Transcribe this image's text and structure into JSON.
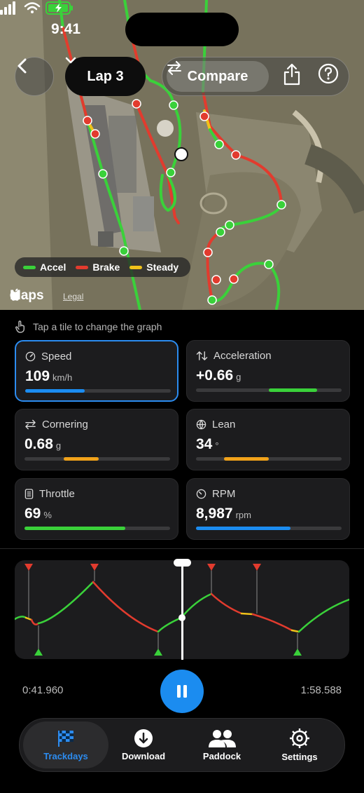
{
  "status_bar": {
    "time": "9:41"
  },
  "map": {
    "lap_label": "Lap 3",
    "compare_label": "Compare",
    "legend": [
      {
        "label": "Accel",
        "color": "#3ad13a"
      },
      {
        "label": "Brake",
        "color": "#e23b2e"
      },
      {
        "label": "Steady",
        "color": "#f0c21a"
      }
    ],
    "attribution": "Maps",
    "legal_label": "Legal"
  },
  "hint": "Tap a tile to change the graph",
  "tiles": [
    {
      "title": "Speed",
      "value": "109",
      "unit": "km/h",
      "icon": "speedometer-icon",
      "bar_color": "#1b8cf0",
      "bar_start": 0.0,
      "bar_end": 0.41,
      "selected": true
    },
    {
      "title": "Acceleration",
      "value": "+0.66",
      "unit": "g",
      "icon": "up-down-arrows-icon",
      "bar_color": "#3ad13a",
      "bar_start": 0.5,
      "bar_end": 0.83,
      "selected": false
    },
    {
      "title": "Cornering",
      "value": "0.68",
      "unit": "g",
      "icon": "left-right-arrows-icon",
      "bar_color": "#f0a21a",
      "bar_start": 0.27,
      "bar_end": 0.51,
      "selected": false
    },
    {
      "title": "Lean",
      "value": "34",
      "unit": "°",
      "icon": "globe-icon",
      "bar_color": "#f0a21a",
      "bar_start": 0.19,
      "bar_end": 0.5,
      "selected": false
    },
    {
      "title": "Throttle",
      "value": "69",
      "unit": "%",
      "icon": "throttle-icon",
      "bar_color": "#3ad13a",
      "bar_start": 0.0,
      "bar_end": 0.69,
      "selected": false
    },
    {
      "title": "RPM",
      "value": "8,987",
      "unit": "rpm",
      "icon": "gauge-icon",
      "bar_color": "#1b8cf0",
      "bar_start": 0.0,
      "bar_end": 0.65,
      "selected": false
    }
  ],
  "playback": {
    "current_time": "0:41.960",
    "total_time": "1:58.588"
  },
  "tabbar": [
    {
      "label": "Trackdays",
      "icon": "checkered-flag-icon",
      "active": true
    },
    {
      "label": "Download",
      "icon": "download-icon",
      "active": false
    },
    {
      "label": "Paddock",
      "icon": "people-icon",
      "active": false
    },
    {
      "label": "Settings",
      "icon": "gear-icon",
      "active": false
    }
  ]
}
